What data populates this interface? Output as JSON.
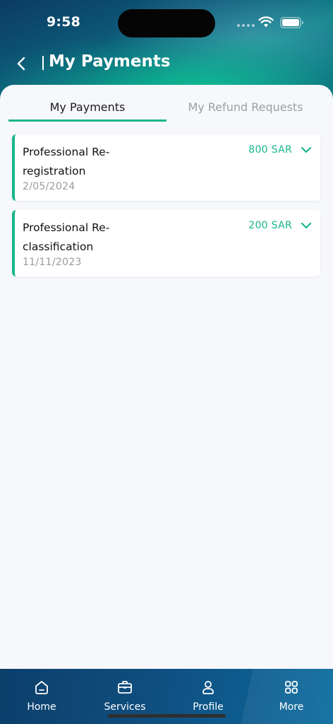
{
  "status_bar": {
    "time": "9:58"
  },
  "header": {
    "title": "My Payments"
  },
  "tabs": [
    {
      "label": "My Payments",
      "active": true
    },
    {
      "label": "My Refund Requests",
      "active": false
    }
  ],
  "payments": [
    {
      "title": "Professional Re-registration",
      "title_line1": "Professional Re-",
      "title_line2": "registration",
      "date": "2/05/2024",
      "amount": "800 SAR"
    },
    {
      "title": "Professional Re-classification",
      "title_line1": "Professional Re-",
      "title_line2": "classification",
      "date": "11/11/2023",
      "amount": "200 SAR"
    }
  ],
  "bottom_nav": [
    {
      "label": "Home",
      "icon": "home-icon"
    },
    {
      "label": "Services",
      "icon": "briefcase-icon"
    },
    {
      "label": "Profile",
      "icon": "user-icon"
    },
    {
      "label": "More",
      "icon": "grid-icon"
    }
  ],
  "colors": {
    "accent": "#18b68c",
    "header_dark": "#0b3b63",
    "nav_bg": "#0f4e7f",
    "background": "#f7f8fb"
  }
}
